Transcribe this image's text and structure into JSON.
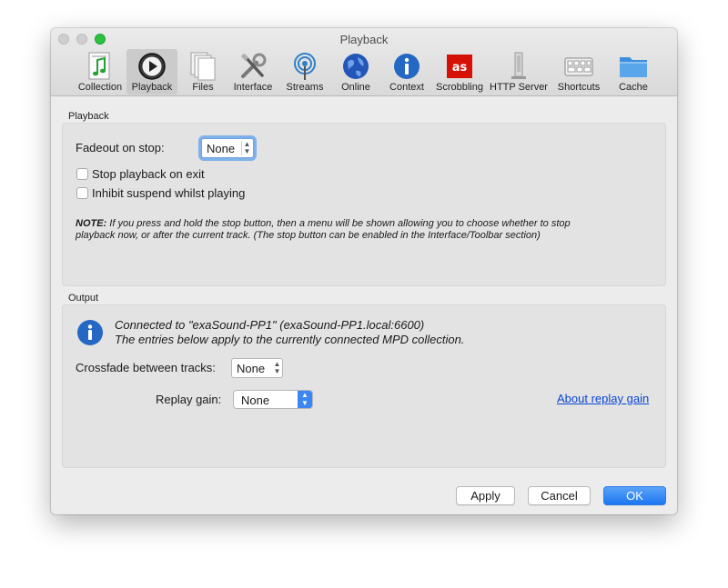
{
  "window": {
    "title": "Playback"
  },
  "toolbar": {
    "items": [
      {
        "label": "Collection",
        "icon": "collection-icon"
      },
      {
        "label": "Playback",
        "icon": "playback-icon",
        "selected": true
      },
      {
        "label": "Files",
        "icon": "files-icon"
      },
      {
        "label": "Interface",
        "icon": "interface-icon"
      },
      {
        "label": "Streams",
        "icon": "streams-icon"
      },
      {
        "label": "Online",
        "icon": "online-icon"
      },
      {
        "label": "Context",
        "icon": "context-icon"
      },
      {
        "label": "Scrobbling",
        "icon": "scrobbling-icon"
      },
      {
        "label": "HTTP Server",
        "icon": "http-server-icon"
      },
      {
        "label": "Shortcuts",
        "icon": "shortcuts-icon"
      },
      {
        "label": "Cache",
        "icon": "cache-icon"
      }
    ]
  },
  "playback": {
    "section_title": "Playback",
    "fadeout_label": "Fadeout on stop:",
    "fadeout_value": "None",
    "stop_on_exit_label": "Stop playback on exit",
    "stop_on_exit_checked": false,
    "inhibit_label": "Inhibit suspend whilst playing",
    "inhibit_checked": false,
    "note_bold": "NOTE:",
    "note_line1": " If you press and hold the stop button, then a menu will be shown allowing you to choose whether to stop",
    "note_line2": "playback now, or after the current track. (The stop button can be enabled in the Interface/Toolbar section)"
  },
  "output": {
    "section_title": "Output",
    "info_line1": "Connected to \"exaSound-PP1\" (exaSound-PP1.local:6600)",
    "info_line2": "The entries below apply to the currently connected MPD collection.",
    "crossfade_label": "Crossfade between tracks:",
    "crossfade_value": "None",
    "replay_gain_label": "Replay gain:",
    "replay_gain_value": "None",
    "about_link": "About replay gain"
  },
  "buttons": {
    "apply": "Apply",
    "cancel": "Cancel",
    "ok": "OK"
  },
  "colors": {
    "accent": "#1c77f2",
    "link": "#0a46d6",
    "zoom": "#2cc13f"
  }
}
